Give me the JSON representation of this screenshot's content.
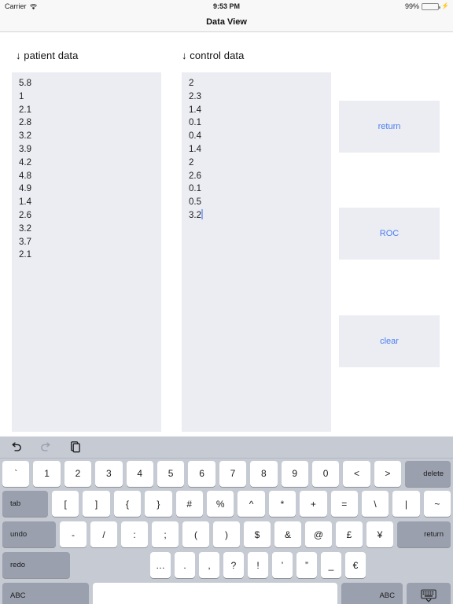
{
  "status_bar": {
    "carrier": "Carrier",
    "wifi_icon": "wifi-icon",
    "time": "9:53 PM",
    "battery_percent": "99%",
    "battery_icon": "battery-icon",
    "charging_icon": "charging-bolt-icon"
  },
  "nav": {
    "title": "Data View"
  },
  "fields": {
    "patient": {
      "label": "↓ patient data",
      "value": "5.8\n1\n2.1\n2.8\n3.2\n3.9\n4.2\n4.8\n4.9\n1.4\n2.6\n3.2\n3.7\n2.1",
      "values": [
        "5.8",
        "1",
        "2.1",
        "2.8",
        "3.2",
        "3.9",
        "4.2",
        "4.8",
        "4.9",
        "1.4",
        "2.6",
        "3.2",
        "3.7",
        "2.1"
      ]
    },
    "control": {
      "label": "↓ control data",
      "value": "2\n2.3\n1.4\n0.1\n0.4\n1.4\n2\n2.6\n0.1\n0.5\n3.2",
      "values": [
        "2",
        "2.3",
        "1.4",
        "0.1",
        "0.4",
        "1.4",
        "2",
        "2.6",
        "0.1",
        "0.5",
        "3.2"
      ]
    }
  },
  "buttons": {
    "return": "return",
    "roc": "ROC",
    "clear": "clear",
    "accent_color": "#4a7ef0",
    "background_color": "#ecedf2"
  },
  "keyboard": {
    "shortcut_bar": {
      "undo_icon": "undo-arrow-icon",
      "redo_icon": "redo-arrow-icon",
      "paste_icon": "paste-icon"
    },
    "row1": [
      "`",
      "1",
      "2",
      "3",
      "4",
      "5",
      "6",
      "7",
      "8",
      "9",
      "0",
      "<",
      ">"
    ],
    "delete": "delete",
    "tab": "tab",
    "row2": [
      "[",
      "]",
      "{",
      "}",
      "#",
      "%",
      "^",
      "*",
      "+",
      "=",
      "\\",
      "|",
      "~"
    ],
    "undo": "undo",
    "row3": [
      "-",
      "/",
      ":",
      ";",
      "(",
      ")",
      "$",
      "&",
      "@",
      "£",
      "¥"
    ],
    "return": "return",
    "redo": "redo",
    "row4": [
      "…",
      ".",
      ",",
      "?",
      "!",
      "’",
      "”",
      "_",
      "€"
    ],
    "abc_left": "ABC",
    "space": "",
    "abc_right": "ABC",
    "dismiss_icon": "keyboard-dismiss-icon"
  }
}
